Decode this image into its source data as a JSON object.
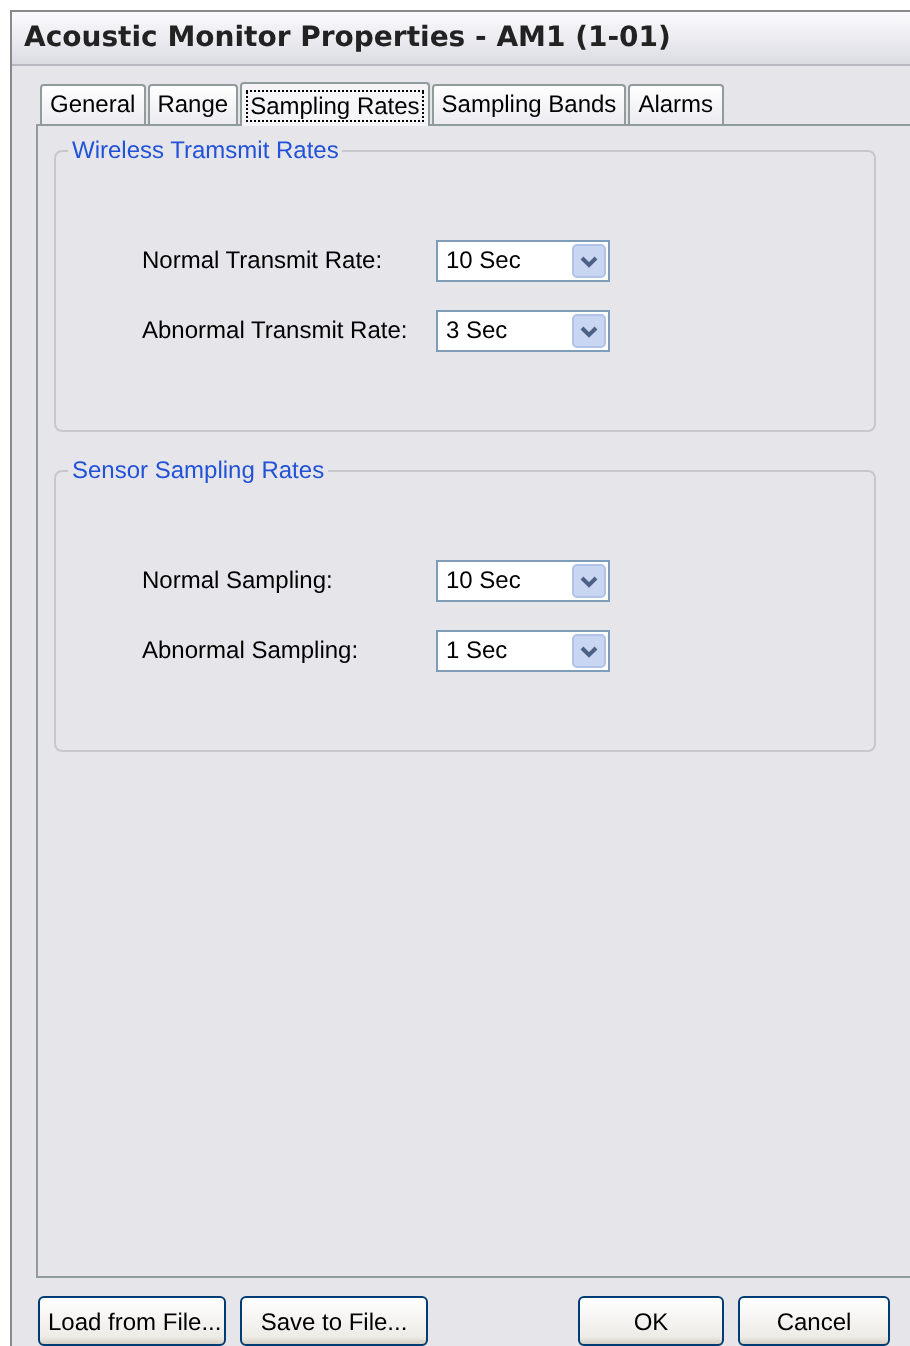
{
  "window": {
    "title": "Acoustic Monitor Properties - AM1 (1-01)"
  },
  "tabs": [
    {
      "label": "General",
      "selected": false
    },
    {
      "label": "Range",
      "selected": false
    },
    {
      "label": "Sampling Rates",
      "selected": true
    },
    {
      "label": "Sampling Bands",
      "selected": false
    },
    {
      "label": "Alarms",
      "selected": false
    }
  ],
  "groups": [
    {
      "title": "Wireless Tramsmit Rates",
      "rows": [
        {
          "label": "Normal Transmit Rate:",
          "value": "10 Sec"
        },
        {
          "label": "Abnormal Transmit Rate:",
          "value": "3 Sec"
        }
      ]
    },
    {
      "title": "Sensor Sampling Rates",
      "rows": [
        {
          "label": "Normal Sampling:",
          "value": "10 Sec"
        },
        {
          "label": "Abnormal Sampling:",
          "value": "1 Sec"
        }
      ]
    }
  ],
  "buttons_left": [
    "Load from File...",
    "Save to File..."
  ],
  "buttons_right": [
    "OK",
    "Cancel"
  ]
}
